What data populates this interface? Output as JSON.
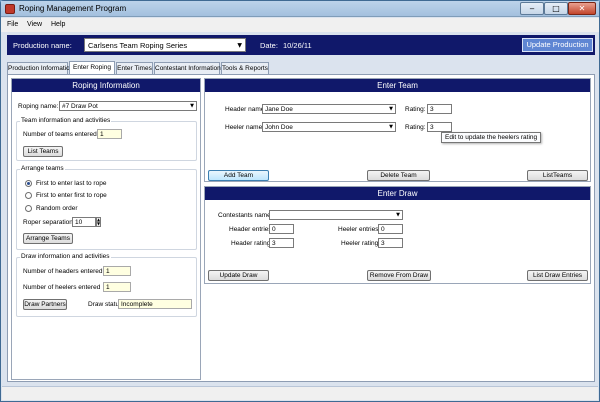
{
  "window": {
    "title": "Roping Management Program",
    "min_glyph": "‒",
    "max_glyph": "□",
    "close_glyph": "✕"
  },
  "menu": {
    "items": [
      "File",
      "View",
      "Help"
    ]
  },
  "production": {
    "label": "Production name:",
    "value": "Carlsens Team Roping Series",
    "date_label": "Date:",
    "date_value": "10/26/11",
    "update_button": "Update Production"
  },
  "tabs": [
    "Production Information",
    "Enter Roping",
    "Enter Times",
    "Contestant Information",
    "Tools & Reports"
  ],
  "active_tab": "Enter Roping",
  "roping_info": {
    "header": "Roping Information",
    "roping_name_label": "Roping name:",
    "roping_name_value": "#7 Draw Pot",
    "team_group": {
      "title": "Team information and activities",
      "teams_entered_label": "Number of teams entered",
      "teams_entered_value": "1",
      "list_teams_button": "List Teams"
    },
    "arrange_group": {
      "title": "Arrange teams",
      "options": [
        "First to enter last to rope",
        "First to enter first to rope",
        "Random order"
      ],
      "selected_index": 0,
      "separation_label": "Roper separation:",
      "separation_value": "10",
      "arrange_button": "Arrange Teams"
    },
    "draw_group": {
      "title": "Draw information and activities",
      "headers_label": "Number of headers entered",
      "headers_value": "1",
      "heelers_label": "Number of heelers entered",
      "heelers_value": "1",
      "draw_partners_button": "Draw Partners",
      "draw_status_label": "Draw status",
      "draw_status_value": "Incomplete"
    }
  },
  "enter_team": {
    "header": "Enter Team",
    "header_name_label": "Header name:",
    "header_name_value": "Jane Doe",
    "heeler_name_label": "Heeler name:",
    "heeler_name_value": "John Doe",
    "rating_label": "Rating:",
    "header_rating": "3",
    "heeler_rating": "3",
    "tooltip": "Edit to update the heelers rating",
    "add_button": "Add Team",
    "delete_button": "Delete Team",
    "list_button": "ListTeams"
  },
  "enter_draw": {
    "header": "Enter Draw",
    "contestants_label": "Contestants name:",
    "contestants_value": "",
    "header_entries_label": "Header entries:",
    "header_entries_value": "0",
    "heeler_entries_label": "Heeler entries:",
    "heeler_entries_value": "0",
    "header_rating_label": "Header rating:",
    "header_rating_value": "3",
    "heeler_rating_label": "Heeler rating:",
    "heeler_rating_value": "3",
    "update_button": "Update Draw",
    "remove_button": "Remove From Draw",
    "list_button": "List Draw Entries"
  },
  "colors": {
    "navy_header": "#10186a",
    "update_button_bg": "#5f86d3",
    "yellow_field": "#ffffe1"
  }
}
